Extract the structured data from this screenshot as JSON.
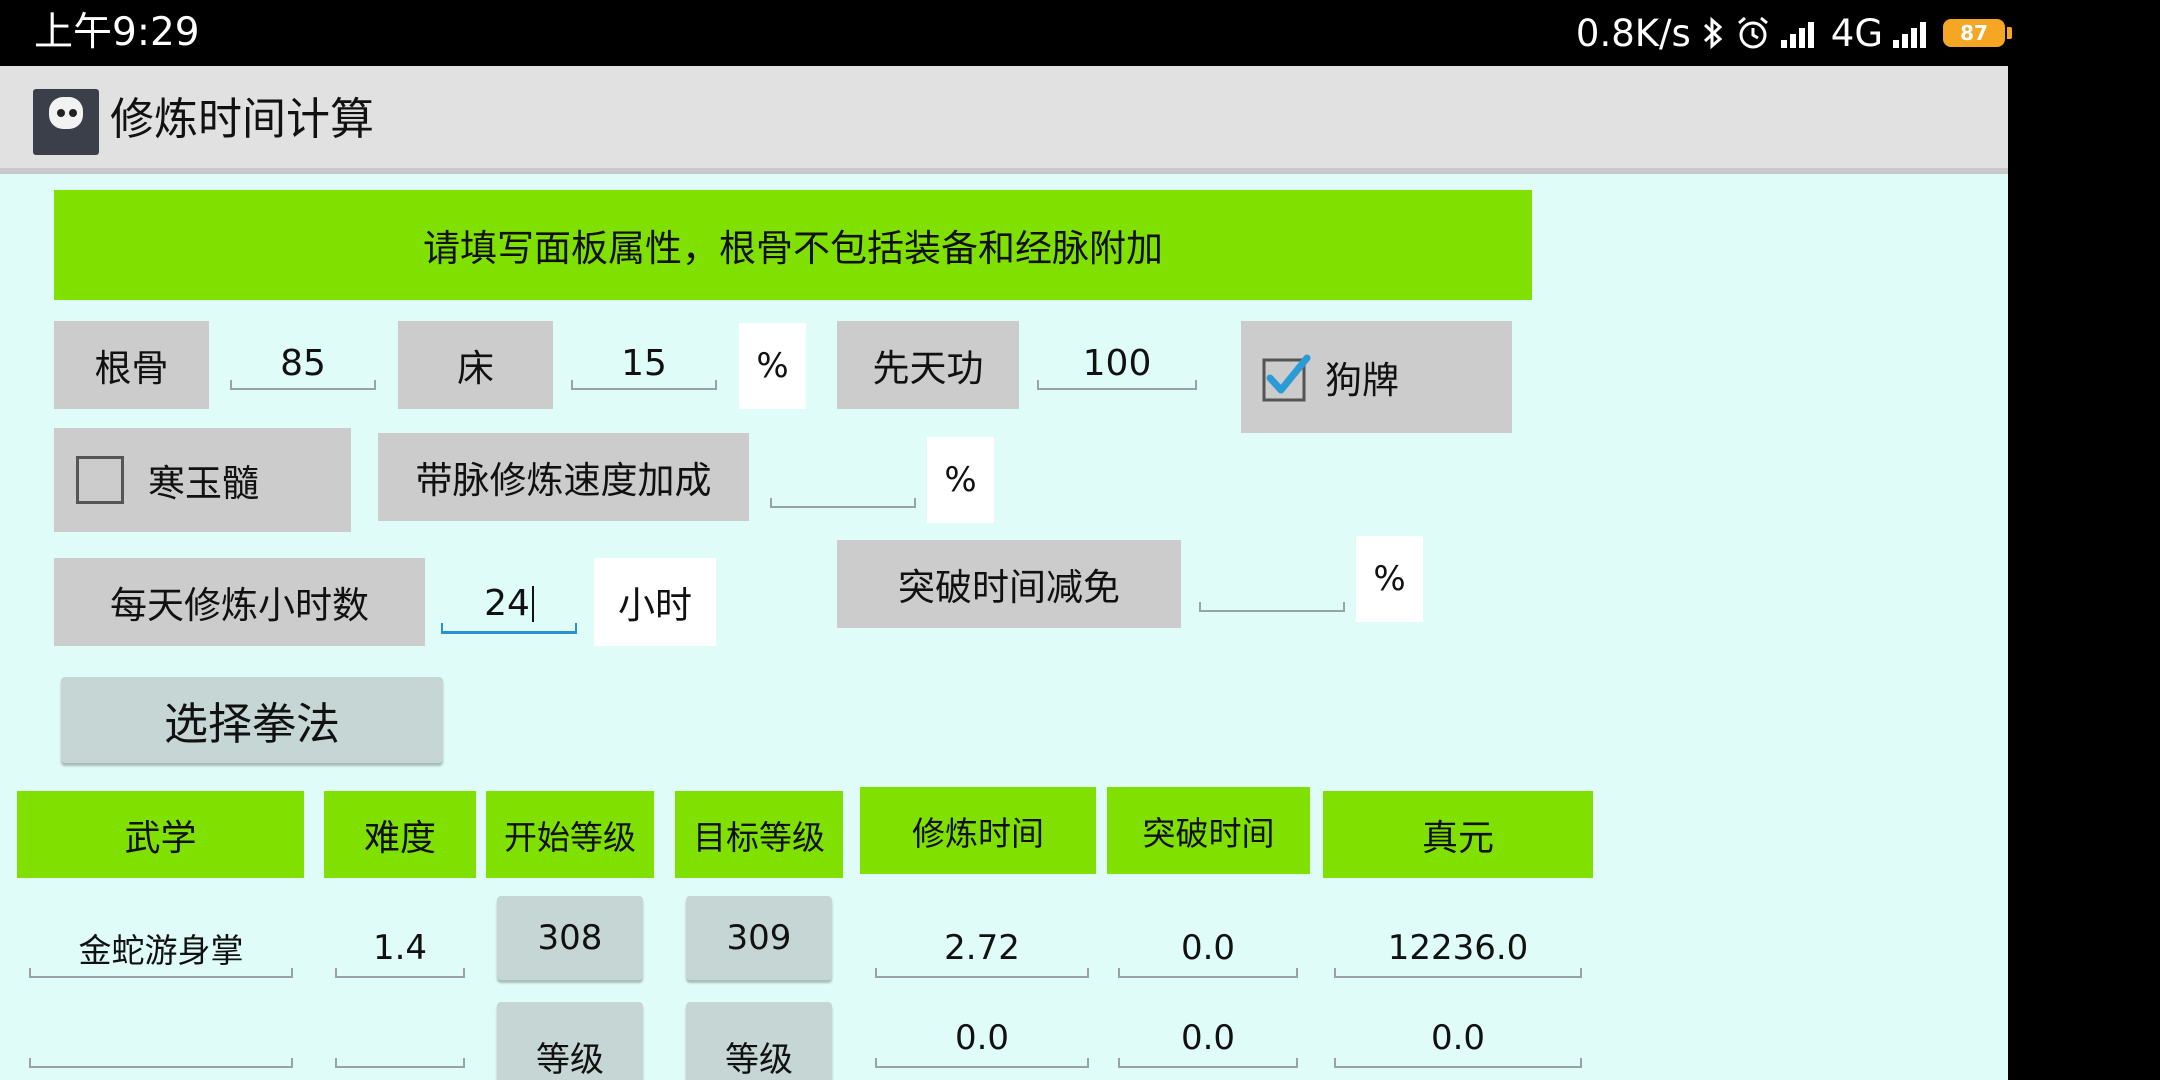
{
  "status_bar": {
    "time": "上午9:29",
    "net_speed": "0.8K/s",
    "network": "4G",
    "battery": "87"
  },
  "app": {
    "title": "修炼时间计算",
    "banner": "请填写面板属性，根骨不包括装备和经脉附加"
  },
  "form": {
    "gengu_label": "根骨",
    "gengu_value": "85",
    "chuang_label": "床",
    "chuang_value": "15",
    "percent": "%",
    "xiantian_label": "先天功",
    "xiantian_value": "100",
    "goupai_label": "狗牌",
    "goupai_checked": true,
    "hanyusui_label": "寒玉髓",
    "hanyusui_checked": false,
    "daimai_label": "带脉修炼速度加成",
    "daimai_value": "",
    "hours_label": "每天修炼小时数",
    "hours_value": "24",
    "hours_unit": "小时",
    "tupo_label": "突破时间减免",
    "tupo_value": "",
    "select_button": "选择拳法"
  },
  "table": {
    "headers": [
      "武学",
      "难度",
      "开始等级",
      "目标等级",
      "修炼时间",
      "突破时间",
      "真元"
    ],
    "rows": [
      {
        "name": "金蛇游身掌",
        "difficulty": "1.4",
        "start": "308",
        "target": "309",
        "train_time": "2.72",
        "break_time": "0.0",
        "zhenyuan": "12236.0"
      },
      {
        "name": "",
        "difficulty": "",
        "start": "等级",
        "target": "等级",
        "train_time": "0.0",
        "break_time": "0.0",
        "zhenyuan": "0.0"
      }
    ]
  }
}
